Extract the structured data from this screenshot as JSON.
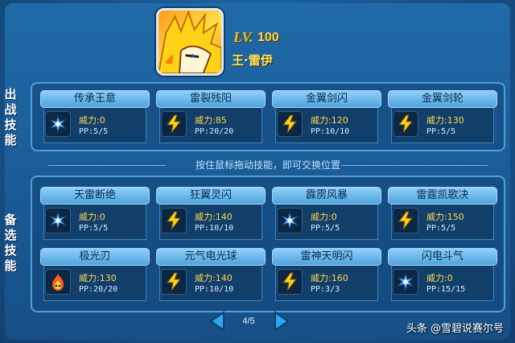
{
  "pet": {
    "level_label": "LV.",
    "level_value": "100",
    "name": "王·雷伊"
  },
  "sections": {
    "battle_label": [
      "出",
      "战",
      "技",
      "能"
    ],
    "reserve_label": [
      "备",
      "选",
      "技",
      "能"
    ]
  },
  "hint": "按住鼠标拖动技能，即可交换位置",
  "battle_skills": [
    {
      "name": "传承王意",
      "icon": "blue-star-icon",
      "power": "威力:0",
      "pp": "PP:5/5"
    },
    {
      "name": "雷裂残阳",
      "icon": "lightning-icon",
      "power": "威力:85",
      "pp": "PP:20/20"
    },
    {
      "name": "金翼剑闪",
      "icon": "lightning-icon",
      "power": "威力:120",
      "pp": "PP:10/10"
    },
    {
      "name": "金翼剑轮",
      "icon": "lightning-icon",
      "power": "威力:130",
      "pp": "PP:5/5"
    }
  ],
  "reserve_skills": [
    {
      "name": "天雷断绝",
      "icon": "blue-star-icon",
      "power": "威力:0",
      "pp": "PP:5/5"
    },
    {
      "name": "狂翼灵闪",
      "icon": "lightning-icon",
      "power": "威力:140",
      "pp": "PP:10/10"
    },
    {
      "name": "霹雳风暴",
      "icon": "blue-star-icon",
      "power": "威力:0",
      "pp": "PP:5/5"
    },
    {
      "name": "雷霆凯歌决",
      "icon": "lightning-icon",
      "power": "威力:150",
      "pp": "PP:5/5"
    },
    {
      "name": "极光刃",
      "icon": "fire-icon",
      "power": "威力:130",
      "pp": "PP:20/20"
    },
    {
      "name": "元气电光球",
      "icon": "lightning-icon",
      "power": "威力:140",
      "pp": "PP:10/10"
    },
    {
      "name": "雷神天明闪",
      "icon": "lightning-icon",
      "power": "威力:160",
      "pp": "PP:3/3"
    },
    {
      "name": "闪电斗气",
      "icon": "blue-star-icon",
      "power": "威力:0",
      "pp": "PP:15/15"
    }
  ],
  "pager": {
    "text": "4/5"
  },
  "watermark": "头条 @雪碧说赛尔号",
  "colors": {
    "accent": "#ffd84a",
    "card_head": "#8fd0fa",
    "panel_border": "#4f9fd8"
  }
}
